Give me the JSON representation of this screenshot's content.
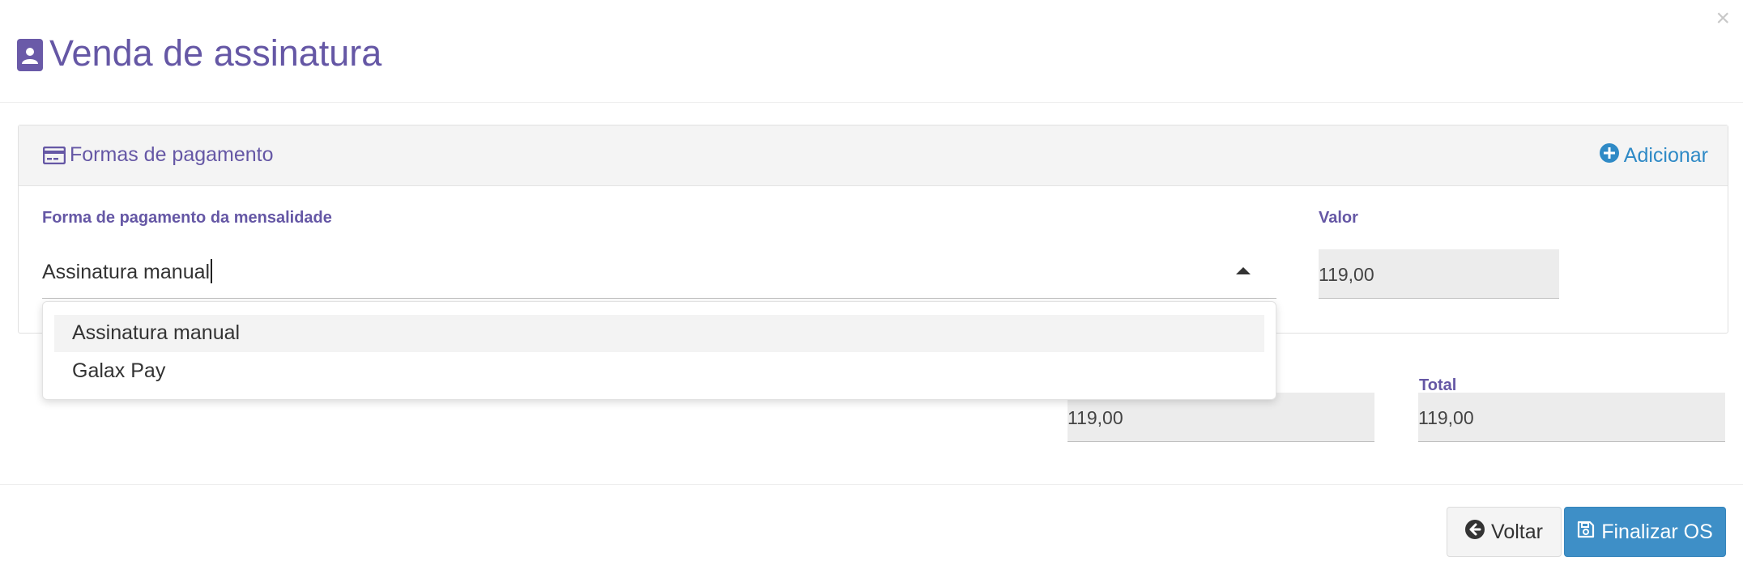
{
  "modal": {
    "title": "Venda de assinatura",
    "close_label": "×"
  },
  "payments_panel": {
    "title": "Formas de pagamento",
    "add_label": "Adicionar",
    "method_label": "Forma de pagamento da mensalidade",
    "method_value": "Assinatura manual",
    "value_label": "Valor",
    "value": "119,00"
  },
  "dropdown": {
    "options": [
      "Assinatura manual",
      "Galax Pay"
    ],
    "highlighted": "Assinatura manual"
  },
  "totals": {
    "subtotal_value": "119,00",
    "total_label": "Total",
    "total_value": "119,00"
  },
  "footer": {
    "back_label": "Voltar",
    "finish_label": "Finalizar OS"
  },
  "colors": {
    "accent_purple": "#6557a5",
    "link_blue": "#2f8ac6",
    "primary_button": "#3e8fc7"
  }
}
